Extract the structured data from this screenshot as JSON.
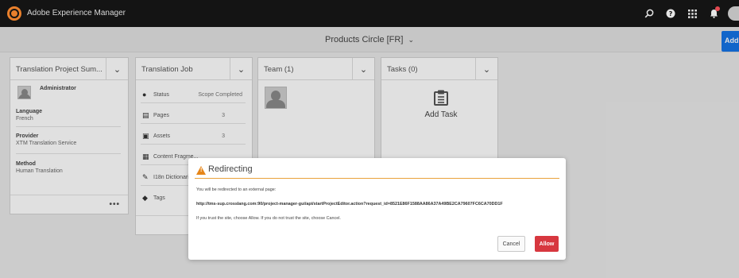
{
  "shell": {
    "app_title": "Adobe Experience Manager",
    "icons": [
      "search-icon",
      "help-icon",
      "apps-grid-icon",
      "notifications-bell-icon",
      "user-avatar"
    ]
  },
  "header": {
    "page_title": "Products Circle [FR]",
    "page_title_icon": "chevron-down-icon",
    "add_label": "Add"
  },
  "cards": {
    "summary": {
      "title": "Translation Project Sum...",
      "user": "Administrator",
      "fields": [
        {
          "label": "Language",
          "value": "French"
        },
        {
          "label": "Provider",
          "value": "XTM Translation Service"
        },
        {
          "label": "Method",
          "value": "Human Translation"
        }
      ],
      "more": "•••"
    },
    "job": {
      "title": "Translation Job",
      "rows": [
        {
          "icon": "info-icon",
          "label": "Status",
          "value": "Scope Completed"
        },
        {
          "icon": "pages-icon",
          "label": "Pages",
          "value": "3"
        },
        {
          "icon": "assets-icon",
          "label": "Assets",
          "value": "3"
        },
        {
          "icon": "content-fragment-icon",
          "label": "Content Fragme...",
          "value": ""
        },
        {
          "icon": "i18n-dictionary-icon",
          "label": "I18n Dictionarie...",
          "value": ""
        },
        {
          "icon": "tag-icon",
          "label": "Tags",
          "value": ""
        }
      ]
    },
    "team": {
      "title": "Team (1)"
    },
    "tasks": {
      "title": "Tasks (0)",
      "add_task": "Add Task"
    }
  },
  "dialog": {
    "title": "Redirecting",
    "intro": "You will be redirected to an external page:",
    "url": "http://tms-sup.crosslang.com:90/project-manager-gui/api/startProjectEditor.action?request_id=8521E86F1588AA86A37A49BE2CA79607FC6CA70DD1F",
    "trust_text": "If you trust the site, choose Allow. If you do not trust the site, choose Cancel.",
    "cancel": "Cancel",
    "allow": "Allow"
  },
  "colors": {
    "shell_bg": "#141414",
    "accent_blue": "#1473e6",
    "allow_red": "#d7373f",
    "warning_orange": "#e68619",
    "logo_orange": "#e9802c"
  }
}
